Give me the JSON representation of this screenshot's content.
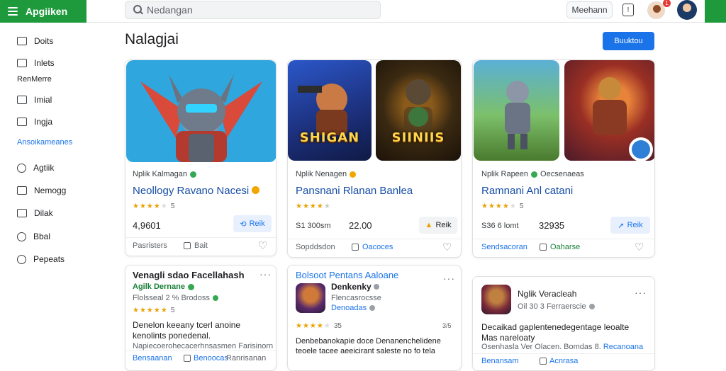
{
  "header": {
    "brand": "Apgiiken",
    "search_placeholder": "Nedangan",
    "top_button": "Meehann",
    "notification_count": "1"
  },
  "sidebar": {
    "items_top": [
      {
        "label": "Doits",
        "icon": "doc-icon"
      },
      {
        "label": "Inlets",
        "icon": "list-icon"
      }
    ],
    "section_label": "RenMerre",
    "items_mid": [
      {
        "label": "Imial",
        "icon": "mail-icon"
      },
      {
        "label": "Ingja",
        "icon": "image-icon"
      }
    ],
    "section_label_2": "Ansoikameanes",
    "items_bottom": [
      {
        "label": "Agtiik",
        "icon": "link-icon"
      },
      {
        "label": "Nemogg",
        "icon": "share-icon"
      },
      {
        "label": "Dilak",
        "icon": "book-icon"
      },
      {
        "label": "Bbal",
        "icon": "clock-icon"
      },
      {
        "label": "Pepeats",
        "icon": "tag-icon"
      }
    ]
  },
  "main": {
    "title": "Nalagjai",
    "action_button": "Buuktou"
  },
  "cards": [
    {
      "art_labels": [
        ""
      ],
      "developer": "Nplik Kalmagan",
      "name": "Neollogy Ravano Nacesi",
      "rating_count": "5",
      "price": "4,9601",
      "get_label": "Reik",
      "footer_left": "Pasristers",
      "footer_mid": "Bait",
      "rating": 4
    },
    {
      "art_labels": [
        "SHIGAN",
        "SIINIIS"
      ],
      "developer": "Nplik Nenagen",
      "name": "Pansnani Rlanan Banlea",
      "rating_count": "",
      "price_left": "S1 300sm",
      "price": "22.00",
      "get_label": "Reik",
      "footer_left": "Sopddsdon",
      "footer_mid": "Oacoces",
      "rating": 4
    },
    {
      "art_labels": [
        "",
        ""
      ],
      "developer": "Nplik Rapeen",
      "developer_2": "Oecsenaeas",
      "name": "Ramnani Anl catani",
      "rating_count": "5",
      "price_left": "S36 6 lomt",
      "price": "32935",
      "get_label": "Reik",
      "footer_left": "Sendsacoran",
      "footer_mid": "Oaharse",
      "rating": 4
    }
  ],
  "list_cards": [
    {
      "title": "Venagli sdao Facellahash",
      "subtitle": "Agilk Dernane",
      "meta": "Flolsseal 2 % Brodoss",
      "rating_count": "5",
      "description": "Denelon keeany tcerl anoine kenolints ponedenal.",
      "extra": "Napiecoerohecacerhnsasmen Farisinorn",
      "footer_left": "Bensaanan",
      "footer_mid": "Benoocas",
      "footer_right": "Ranrisanan"
    },
    {
      "title": "Bolsoot Pentans Aaloane",
      "developer": "Denkenky",
      "meta": "Flencasrocsse",
      "sub": "Denoadas",
      "rating_count": "35",
      "rating_right": "3/5",
      "description": "Denbebanokapie doce Denanenchelidene teoele tacee aeeicirant saleste no fo tela",
      "rating": 4
    },
    {
      "title": "Nglik Veracleah",
      "meta": "Oil 30 3 Ferraerscie",
      "description": "Decaikad gaplentenedegentage leoalte Mas nareloaty",
      "extra": "Osenhasla Ver Olacen. Bomdas 8.",
      "extra_link": "Recanoana",
      "footer_left": "Benansam",
      "footer_mid": "Acnrasa"
    }
  ],
  "colors": {
    "brand_green": "#1e9a3c",
    "accent_blue": "#1a73e8",
    "star_gold": "#e8a200"
  }
}
